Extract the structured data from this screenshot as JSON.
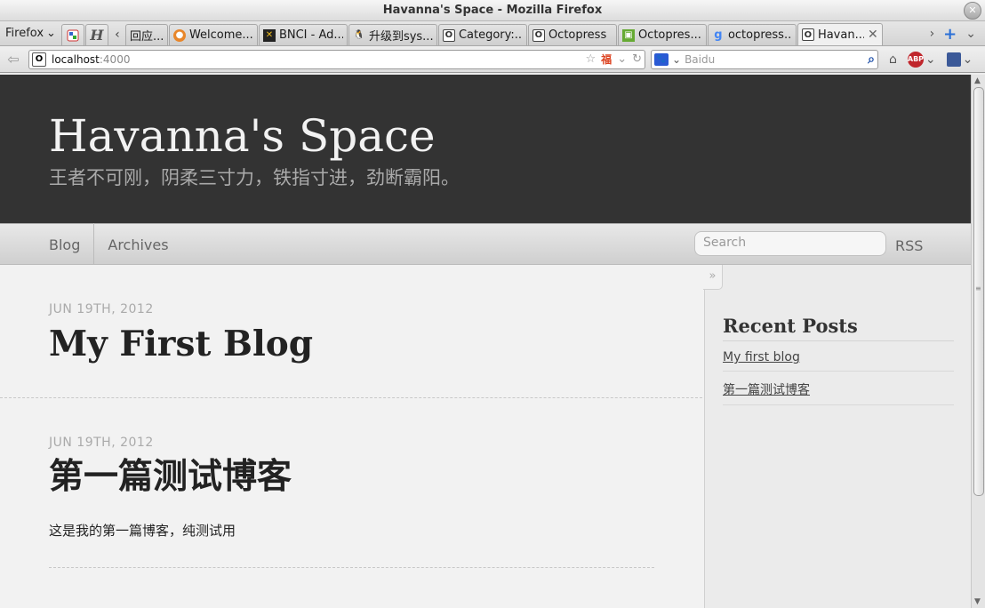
{
  "window": {
    "title": "Havanna's Space - Mozilla Firefox"
  },
  "tabs": {
    "firefox_menu": "Firefox",
    "items": [
      {
        "label": "回应..."
      },
      {
        "label": "Welcome..."
      },
      {
        "label": "BNCI - Ad..."
      },
      {
        "label": "升级到sys..."
      },
      {
        "label": "Category:..."
      },
      {
        "label": "Octopress"
      },
      {
        "label": "Octopres..."
      },
      {
        "label": "octopress..."
      },
      {
        "label": "Havan..."
      }
    ]
  },
  "navbar": {
    "url_host": "localhost",
    "url_port": ":4000",
    "search_engine": "Baidu",
    "site_icon": "O"
  },
  "site": {
    "title": "Havanna's Space",
    "subtitle": "王者不可刚，阴柔三寸力，铁指寸进，劲断霸阳。",
    "nav": {
      "blog": "Blog",
      "archives": "Archives",
      "search_placeholder": "Search",
      "rss": "RSS"
    }
  },
  "articles": [
    {
      "date": "JUN 19TH, 2012",
      "title": "My First Blog",
      "body": ""
    },
    {
      "date": "JUN 19TH, 2012",
      "title": "第一篇测试博客",
      "body": "这是我的第一篇博客，纯测试用"
    }
  ],
  "sidebar": {
    "toggle": "»",
    "heading": "Recent Posts",
    "posts": [
      "My first blog",
      "第一篇测试博客"
    ]
  },
  "colors": {
    "header_bg": "#333333",
    "page_bg": "#f2f2f2",
    "accent": "#2a6fd6"
  }
}
